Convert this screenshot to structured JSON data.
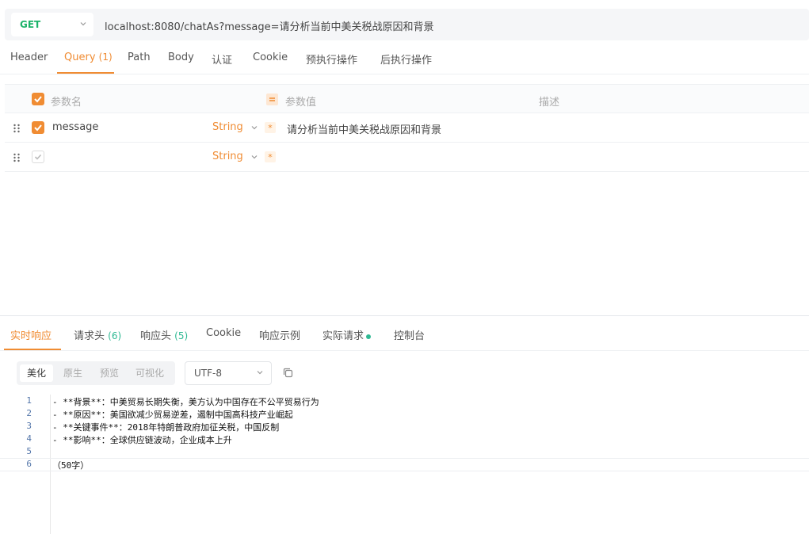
{
  "request": {
    "method": "GET",
    "url": "localhost:8080/chatAs?message=请分析当前中美关税战原因和背景"
  },
  "request_tabs": [
    {
      "label": "Header",
      "count": ""
    },
    {
      "label": "Query",
      "count": "(1)"
    },
    {
      "label": "Path",
      "count": ""
    },
    {
      "label": "Body",
      "count": ""
    },
    {
      "label": "认证",
      "count": ""
    },
    {
      "label": "Cookie",
      "count": ""
    },
    {
      "label": "预执行操作",
      "count": ""
    },
    {
      "label": "后执行操作",
      "count": ""
    }
  ],
  "params": {
    "headers": {
      "name": "参数名",
      "value": "参数值",
      "desc": "描述"
    },
    "rows": [
      {
        "name": "message",
        "type": "String",
        "value": "请分析当前中美关税战原因和背景"
      },
      {
        "name": "",
        "type": "String",
        "value": ""
      }
    ]
  },
  "response_tabs": [
    {
      "label": "实时响应",
      "count": ""
    },
    {
      "label": "请求头",
      "count": "(6)"
    },
    {
      "label": "响应头",
      "count": "(5)"
    },
    {
      "label": "Cookie",
      "count": ""
    },
    {
      "label": "响应示例",
      "count": ""
    },
    {
      "label": "实际请求",
      "count": ""
    },
    {
      "label": "控制台",
      "count": ""
    }
  ],
  "view_modes": [
    "美化",
    "原生",
    "预览",
    "可视化"
  ],
  "encoding": "UTF-8",
  "code_lines": [
    {
      "n": "1",
      "text": "- **背景**：中美贸易长期失衡，美方认为中国存在不公平贸易行为"
    },
    {
      "n": "2",
      "text": "- **原因**：美国欲减少贸易逆差，遏制中国高科技产业崛起"
    },
    {
      "n": "3",
      "text": "- **关键事件**：2018年特朗普政府加征关税，中国反制"
    },
    {
      "n": "4",
      "text": "- **影响**：全球供应链波动，企业成本上升"
    },
    {
      "n": "5",
      "text": ""
    },
    {
      "n": "6",
      "text": "（50字）"
    }
  ],
  "colors": {
    "accent": "#f08c33",
    "green": "#2fb993",
    "method": "#1db36a"
  }
}
